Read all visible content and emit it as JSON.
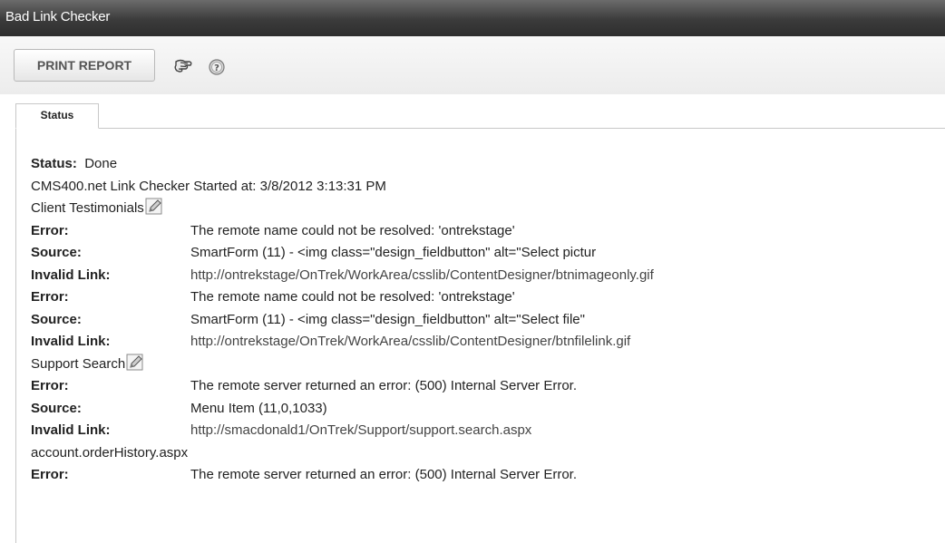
{
  "window": {
    "title": "Bad Link Checker"
  },
  "toolbar": {
    "print_label": "PRINT REPORT",
    "icons": [
      "view-all-icon",
      "help-icon"
    ]
  },
  "tabs": [
    {
      "label": "Status"
    }
  ],
  "report": {
    "status_label": "Status:",
    "status_value": "Done",
    "started_text": "CMS400.net Link Checker Started at: 3/8/2012 3:13:31 PM",
    "labels": {
      "error": "Error:",
      "source": "Source:",
      "invalid_link": "Invalid Link:"
    },
    "groups": [
      {
        "name": "Client Testimonials",
        "has_edit_icon": true,
        "entries": [
          {
            "error": "The remote name could not be resolved: 'ontrekstage'",
            "source": "SmartForm (11) - <img class=\"design_fieldbutton\" alt=\"Select pictur",
            "invalid_link": "http://ontrekstage/OnTrek/WorkArea/csslib/ContentDesigner/btnimageonly.gif"
          },
          {
            "error": "The remote name could not be resolved: 'ontrekstage'",
            "source": "SmartForm (11) - <img class=\"design_fieldbutton\" alt=\"Select file\"",
            "invalid_link": "http://ontrekstage/OnTrek/WorkArea/csslib/ContentDesigner/btnfilelink.gif"
          }
        ]
      },
      {
        "name": "Support Search",
        "has_edit_icon": true,
        "entries": [
          {
            "error": "The remote server returned an error: (500) Internal Server Error.",
            "source": "Menu Item (11,0,1033)",
            "invalid_link": "http://smacdonald1/OnTrek/Support/support.search.aspx"
          }
        ]
      },
      {
        "name": "account.orderHistory.aspx",
        "has_edit_icon": false,
        "entries": [
          {
            "error": "The remote server returned an error: (500) Internal Server Error."
          }
        ]
      }
    ]
  }
}
